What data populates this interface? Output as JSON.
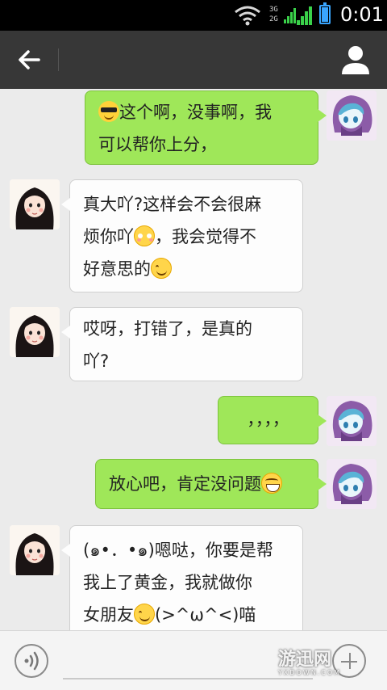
{
  "status_bar": {
    "network_top": "3G",
    "network_bottom": "2G",
    "time": "0:01",
    "battery_level": 0.9
  },
  "header": {
    "title": ""
  },
  "messages": [
    {
      "sender": "me",
      "parts": [
        {
          "emoji": "cool-emoji"
        },
        {
          "text": "这个啊，没事啊，我"
        },
        {
          "text": "可以帮你上分，",
          "br": true
        }
      ]
    },
    {
      "sender": "her",
      "parts": [
        {
          "text": "真大吖?这样会不会很麻"
        },
        {
          "text": "烦你吖",
          "br": true
        },
        {
          "emoji": "shy-emoji"
        },
        {
          "text": "，我会觉得不"
        },
        {
          "text": "好意思的",
          "br": true
        },
        {
          "emoji": "smile-emoji"
        }
      ]
    },
    {
      "sender": "her",
      "parts": [
        {
          "text": "哎呀，打错了，是真的"
        },
        {
          "text": "吖?",
          "br": true
        }
      ]
    },
    {
      "sender": "me",
      "parts": [
        {
          "text": "，，，，"
        }
      ]
    },
    {
      "sender": "me",
      "parts": [
        {
          "text": "放心吧，肯定没问题"
        },
        {
          "emoji": "grin-emoji"
        }
      ]
    },
    {
      "sender": "her",
      "parts": [
        {
          "text": "(๑•．•๑)嗯哒，你要是帮"
        },
        {
          "text": "我上了黄金，我就做你",
          "br": true
        },
        {
          "text": "女朋友",
          "br": true
        },
        {
          "emoji": "smile-emoji"
        },
        {
          "text": "(>^ω^<)喵"
        }
      ]
    }
  ],
  "input": {
    "value": "",
    "placeholder": ""
  },
  "watermark": {
    "main": "游迅网",
    "sub": "YXDOWN.COM"
  },
  "colors": {
    "my_bubble": "#9fe759",
    "her_bubble": "#fdfdfd",
    "title_bar": "#373737",
    "status_bar": "#000000",
    "chat_bg": "#ebebeb"
  }
}
